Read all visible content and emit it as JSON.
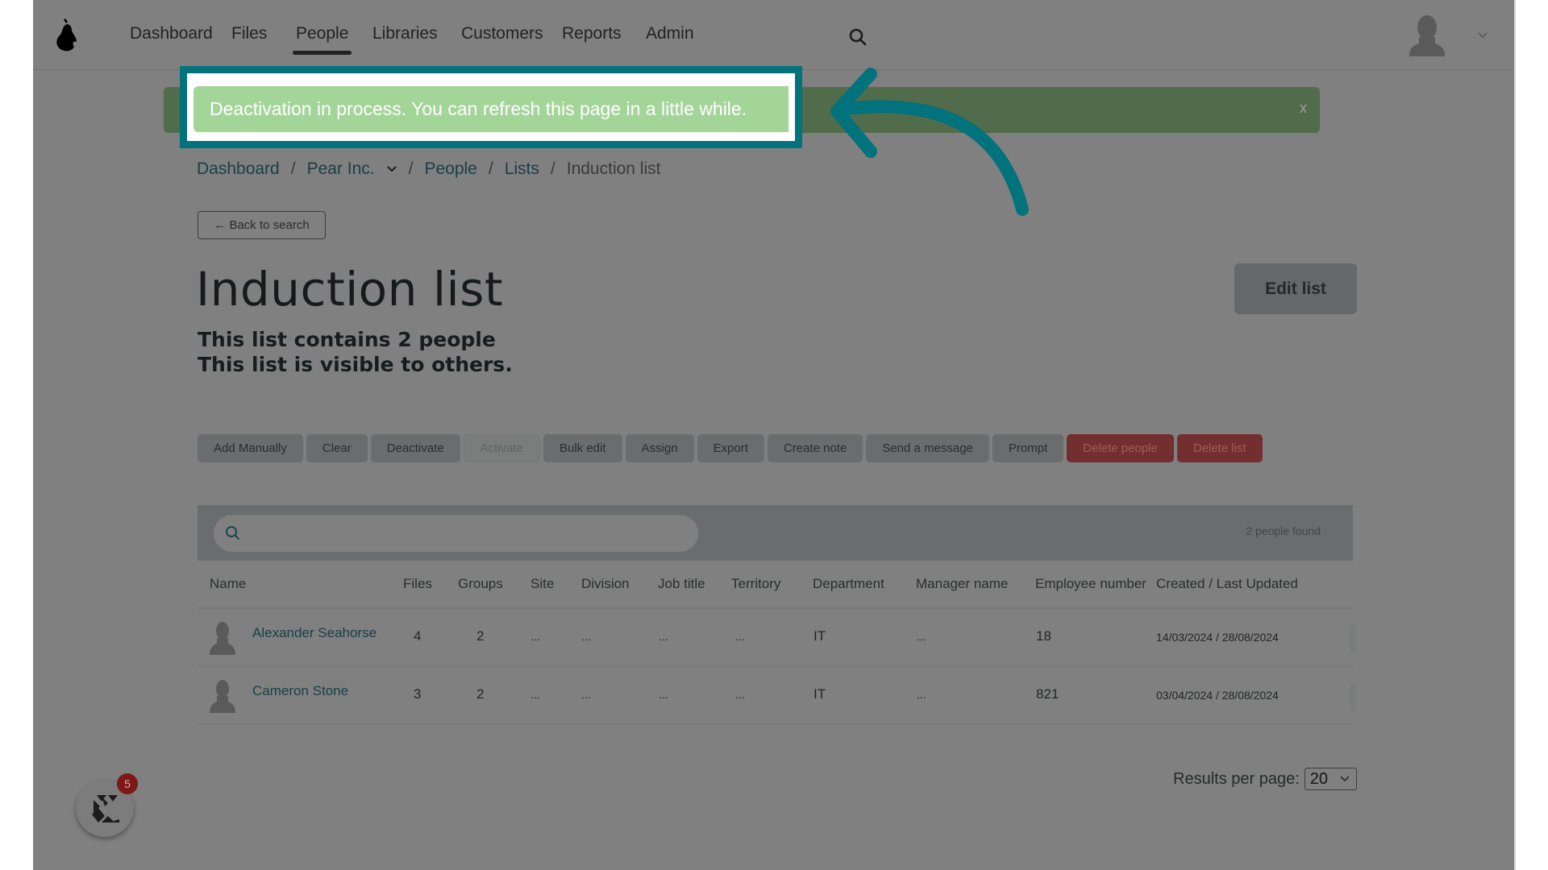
{
  "nav": {
    "items": [
      {
        "label": "Dashboard",
        "active": false
      },
      {
        "label": "Files",
        "active": false
      },
      {
        "label": "People",
        "active": true
      },
      {
        "label": "Libraries",
        "active": false
      },
      {
        "label": "Customers",
        "active": false
      },
      {
        "label": "Reports",
        "active": false
      },
      {
        "label": "Admin",
        "active": false
      }
    ],
    "logo_icon": "pear-logo-icon",
    "search_icon": "search-icon",
    "user_icon": "user-avatar-icon"
  },
  "alert": {
    "message": "Deactivation in process. You can refresh this page in a little while.",
    "close_label": "x",
    "highlight_color": "#02727d",
    "background_color": "#a3d498"
  },
  "breadcrumb": {
    "items": [
      "Dashboard",
      "Pear Inc.",
      "People",
      "Lists"
    ],
    "current": "Induction list",
    "separator": "/"
  },
  "back_button": {
    "label": "← Back to search"
  },
  "page": {
    "title": "Induction list",
    "summary_count": "This list contains 2 people",
    "summary_visibility": "This list is visible to others.",
    "edit_button": "Edit list"
  },
  "actions": [
    {
      "label": "Add Manually",
      "state": "normal"
    },
    {
      "label": "Clear",
      "state": "normal"
    },
    {
      "label": "Deactivate",
      "state": "normal"
    },
    {
      "label": "Activate",
      "state": "disabled"
    },
    {
      "label": "Bulk edit",
      "state": "normal"
    },
    {
      "label": "Assign",
      "state": "normal"
    },
    {
      "label": "Export",
      "state": "normal"
    },
    {
      "label": "Create note",
      "state": "normal"
    },
    {
      "label": "Send a message",
      "state": "normal"
    },
    {
      "label": "Prompt",
      "state": "normal"
    },
    {
      "label": "Delete people",
      "state": "danger"
    },
    {
      "label": "Delete list",
      "state": "danger"
    }
  ],
  "search": {
    "value": "",
    "placeholder": "",
    "results_text": "2 people found"
  },
  "table": {
    "columns": [
      "Name",
      "Files",
      "Groups",
      "Site",
      "Division",
      "Job title",
      "Territory",
      "Department",
      "Manager name",
      "Employee number",
      "Created / Last Updated"
    ],
    "rows": [
      {
        "name": "Alexander Seahorse",
        "files": "4",
        "groups": "2",
        "site": "...",
        "division": "...",
        "job_title": "...",
        "territory": "...",
        "department": "IT",
        "manager": "...",
        "employee_number": "18",
        "dates": "14/03/2024 / 28/08/2024"
      },
      {
        "name": "Cameron Stone",
        "files": "3",
        "groups": "2",
        "site": "...",
        "division": "...",
        "job_title": "...",
        "territory": "...",
        "department": "IT",
        "manager": "...",
        "employee_number": "821",
        "dates": "03/04/2024 / 28/08/2024"
      }
    ]
  },
  "pagination": {
    "label": "Results per page:",
    "selected": "20"
  },
  "widget": {
    "badge_count": "5",
    "icon": "chat-widget-icon"
  }
}
